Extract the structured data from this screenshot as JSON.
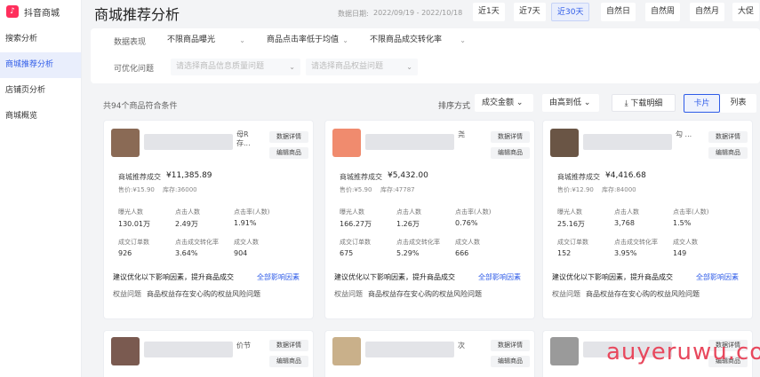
{
  "brand": {
    "name": "抖音商城"
  },
  "sidebar": {
    "items": [
      {
        "label": "搜索分析"
      },
      {
        "label": "商城推荐分析"
      },
      {
        "label": "店铺页分析"
      },
      {
        "label": "商城概览"
      }
    ]
  },
  "header": {
    "title": "商城推荐分析",
    "date_label": "数据日期:",
    "date_value": "2022/09/19 - 2022/10/18",
    "ranges": [
      "近1天",
      "近7天",
      "近30天",
      "自然日",
      "自然周",
      "自然月",
      "大促"
    ]
  },
  "filters": {
    "data_label": "数据表现",
    "data_selects": [
      "不限商品曝光",
      "商品点击率低于均值",
      "不限商品成交转化率"
    ],
    "opt_label": "可优化问题",
    "opt_selects": [
      "请选择商品信息质量问题",
      "请选择商品权益问题"
    ]
  },
  "toolbar": {
    "result_count": "共94个商品符合条件",
    "sort_label": "排序方式",
    "sort_field": "成交金额",
    "sort_order": "由高到低",
    "download": "下载明细",
    "view_card": "卡片",
    "view_list": "列表"
  },
  "card_common": {
    "btn_detail": "数据详情",
    "btn_edit": "编辑商品",
    "mall_label": "商城推荐成交",
    "metric_labels": [
      "曝光人数",
      "点击人数",
      "点击率(人数)",
      "成交订单数",
      "点击成交转化率",
      "成交人数"
    ],
    "suggest": "建议优化以下影响因素，提升商品成交",
    "all_factors": "全部影响因素",
    "issue_type": "权益问题",
    "issue_desc": "商品权益存在安心购的权益风险问题"
  },
  "cards": [
    {
      "title_frag": "母R 存...",
      "mall_value": "¥11,385.89",
      "price": "售价:¥15.90",
      "stock": "库存:36000",
      "metrics": [
        "130.01万",
        "2.49万",
        "1.91%",
        "926",
        "3.64%",
        "904"
      ],
      "thumb_color": "#8a6a55"
    },
    {
      "title_frag": "尧",
      "mall_value": "¥5,432.00",
      "price": "售价:¥5.90",
      "stock": "库存:47787",
      "metrics": [
        "166.27万",
        "1.26万",
        "0.76%",
        "675",
        "5.29%",
        "666"
      ],
      "thumb_color": "#f08b6e"
    },
    {
      "title_frag": "勾 ...",
      "mall_value": "¥4,416.68",
      "price": "售价:¥12.90",
      "stock": "库存:84000",
      "metrics": [
        "25.16万",
        "3,768",
        "1.5%",
        "152",
        "3.95%",
        "149"
      ],
      "thumb_color": "#6a5545"
    }
  ],
  "cards_row2": [
    {
      "title_frag": "价节",
      "thumb_color": "#7a5a50"
    },
    {
      "title_frag": "次",
      "thumb_color": "#c9b08a"
    },
    {
      "title_frag": "",
      "thumb_color": "#9a9a9a"
    }
  ],
  "watermark": "auyeruwu.com"
}
